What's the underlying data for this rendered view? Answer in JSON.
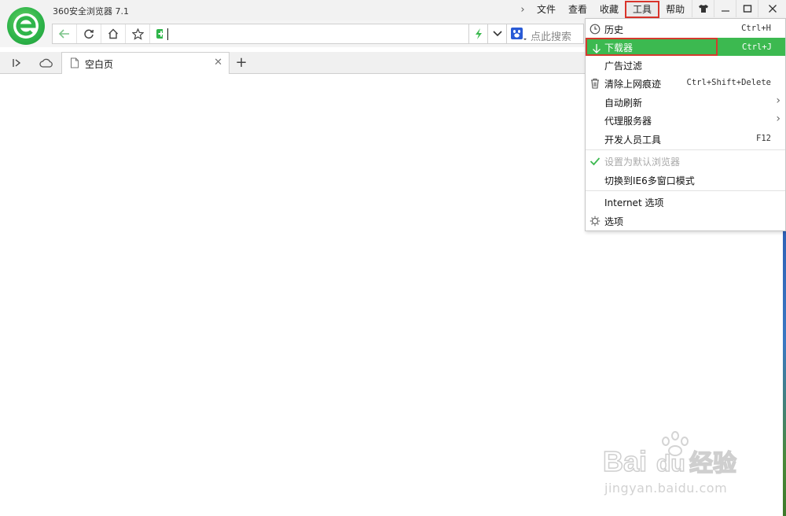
{
  "app": {
    "title": "360安全浏览器 7.1"
  },
  "menubar": {
    "items": [
      {
        "label": "文件"
      },
      {
        "label": "查看"
      },
      {
        "label": "收藏"
      },
      {
        "label": "工具"
      },
      {
        "label": "帮助"
      }
    ]
  },
  "search": {
    "placeholder": "点此搜索"
  },
  "tab": {
    "title": "空白页"
  },
  "dropdown": {
    "items": [
      {
        "label": "历史",
        "shortcut": "Ctrl+H"
      },
      {
        "label": "下载器",
        "shortcut": "Ctrl+J"
      },
      {
        "label": "广告过滤"
      },
      {
        "label": "清除上网痕迹",
        "shortcut": "Ctrl+Shift+Delete"
      },
      {
        "label": "自动刷新"
      },
      {
        "label": "代理服务器"
      },
      {
        "label": "开发人员工具",
        "shortcut": "F12"
      },
      {
        "label": "设置为默认浏览器"
      },
      {
        "label": "切换到IE6多窗口模式"
      },
      {
        "label": "Internet 选项"
      },
      {
        "label": "选项"
      }
    ]
  },
  "watermark": {
    "brand": "Bai",
    "brand_cn": "经验",
    "url": "jingyan.baidu.com"
  },
  "colors": {
    "accent_green": "#3cb950",
    "highlight_border": "#d33b2e",
    "logo_green": "#2fb54a"
  }
}
